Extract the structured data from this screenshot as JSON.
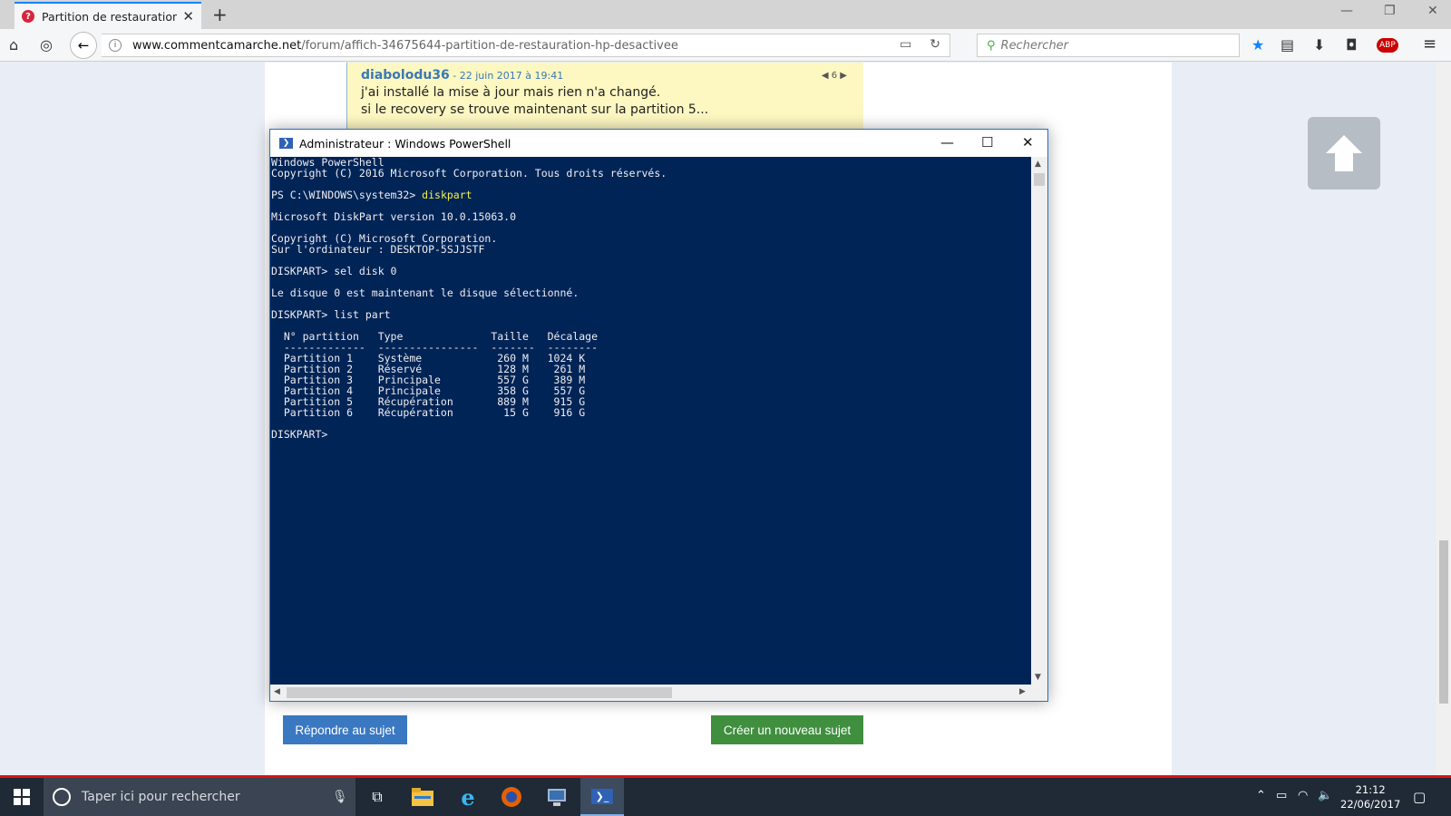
{
  "browser": {
    "tab_title": "Partition de restauration Hp",
    "url_domain": "www.commentcamarche.net",
    "url_path": "/forum/affich-34675644-partition-de-restauration-hp-desactivee",
    "search_placeholder": "Rechercher",
    "abp_label": "ABP"
  },
  "reply": {
    "author": "diabolodu36",
    "date": " - 22 juin 2017 à 19:41",
    "nav_count": "6",
    "lines": [
      "j'ai installé la mise à jour mais rien n'a changé.",
      "si le recovery se trouve maintenant sur la partition 5..."
    ]
  },
  "buttons": {
    "reply": "Répondre au sujet",
    "new_topic": "Créer un nouveau sujet"
  },
  "powershell": {
    "title": "Administrateur : Windows PowerShell",
    "lines": [
      {
        "text": "Windows PowerShell"
      },
      {
        "text": "Copyright (C) 2016 Microsoft Corporation. Tous droits réservés."
      },
      {
        "text": ""
      },
      {
        "prefix": "PS C:\\WINDOWS\\system32> ",
        "command": "diskpart"
      },
      {
        "text": ""
      },
      {
        "text": "Microsoft DiskPart version 10.0.15063.0"
      },
      {
        "text": ""
      },
      {
        "text": "Copyright (C) Microsoft Corporation."
      },
      {
        "text": "Sur l'ordinateur : DESKTOP-5SJJSTF"
      },
      {
        "text": ""
      },
      {
        "text": "DISKPART> sel disk 0"
      },
      {
        "text": ""
      },
      {
        "text": "Le disque 0 est maintenant le disque sélectionné."
      },
      {
        "text": ""
      },
      {
        "text": "DISKPART> list part"
      },
      {
        "text": ""
      },
      {
        "text": "  N° partition   Type              Taille   Décalage"
      },
      {
        "text": "  -------------  ----------------  -------  --------"
      },
      {
        "text": "  Partition 1    Système            260 M   1024 K"
      },
      {
        "text": "  Partition 2    Réservé            128 M    261 M"
      },
      {
        "text": "  Partition 3    Principale         557 G    389 M"
      },
      {
        "text": "  Partition 4    Principale         358 G    557 G"
      },
      {
        "text": "  Partition 5    Récupération       889 M    915 G"
      },
      {
        "text": "  Partition 6    Récupération        15 G    916 G"
      },
      {
        "text": ""
      },
      {
        "text": "DISKPART> "
      }
    ]
  },
  "taskbar": {
    "search_placeholder": "Taper ici pour rechercher",
    "time": "21:12",
    "date": "22/06/2017"
  },
  "colors": {
    "console_bg": "#012456",
    "console_text": "#eeedf0",
    "command_yellow": "#f7f04a",
    "reply_button": "#3a78c2",
    "new_topic_button": "#3f8f3f"
  }
}
